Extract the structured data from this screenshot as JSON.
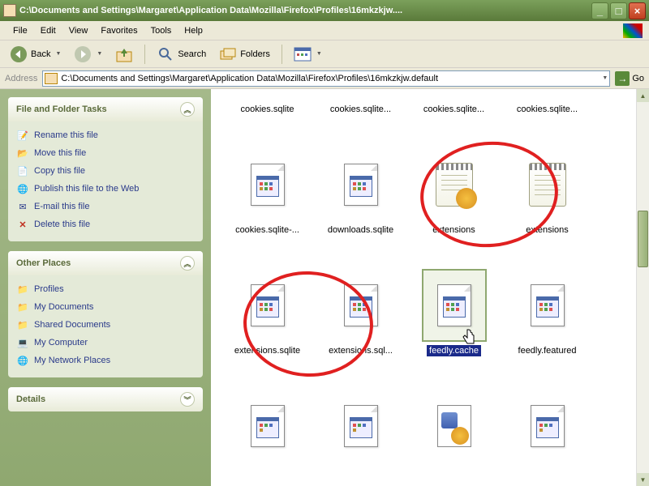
{
  "window": {
    "title": "C:\\Documents and Settings\\Margaret\\Application Data\\Mozilla\\Firefox\\Profiles\\16mkzkjw...."
  },
  "menu": {
    "file": "File",
    "edit": "Edit",
    "view": "View",
    "favorites": "Favorites",
    "tools": "Tools",
    "help": "Help"
  },
  "toolbar": {
    "back": "Back",
    "search": "Search",
    "folders": "Folders"
  },
  "address": {
    "label": "Address",
    "value": "C:\\Documents and Settings\\Margaret\\Application Data\\Mozilla\\Firefox\\Profiles\\16mkzkjw.default",
    "go": "Go"
  },
  "sidebar": {
    "tasks": {
      "title": "File and Folder Tasks",
      "items": [
        "Rename this file",
        "Move this file",
        "Copy this file",
        "Publish this file to the Web",
        "E-mail this file",
        "Delete this file"
      ]
    },
    "places": {
      "title": "Other Places",
      "items": [
        "Profiles",
        "My Documents",
        "Shared Documents",
        "My Computer",
        "My Network Places"
      ]
    },
    "details": {
      "title": "Details"
    }
  },
  "files": {
    "row0": [
      {
        "label": "cookies.sqlite",
        "type": "doc"
      },
      {
        "label": "cookies.sqlite...",
        "type": "doc"
      },
      {
        "label": "cookies.sqlite...",
        "type": "doc"
      },
      {
        "label": "cookies.sqlite...",
        "type": "doc"
      }
    ],
    "row1": [
      {
        "label": "cookies.sqlite-...",
        "type": "doc"
      },
      {
        "label": "downloads.sqlite",
        "type": "doc"
      },
      {
        "label": "extensions",
        "type": "notepad"
      },
      {
        "label": "extensions",
        "type": "notepad-plain"
      }
    ],
    "row2": [
      {
        "label": "extensions.sqlite",
        "type": "doc"
      },
      {
        "label": "extensions.sql...",
        "type": "doc"
      },
      {
        "label": "feedly.cache",
        "type": "doc",
        "selected": true
      },
      {
        "label": "feedly.featured",
        "type": "doc"
      }
    ],
    "row3": [
      {
        "label": "",
        "type": "doc"
      },
      {
        "label": "",
        "type": "doc"
      },
      {
        "label": "",
        "type": "gear"
      },
      {
        "label": "",
        "type": "doc"
      }
    ]
  },
  "colors": {
    "titlebar": "#7ba05b",
    "sidebar": "#a5b98a",
    "selection": "#1a2a8a",
    "annotation": "#e02020"
  }
}
